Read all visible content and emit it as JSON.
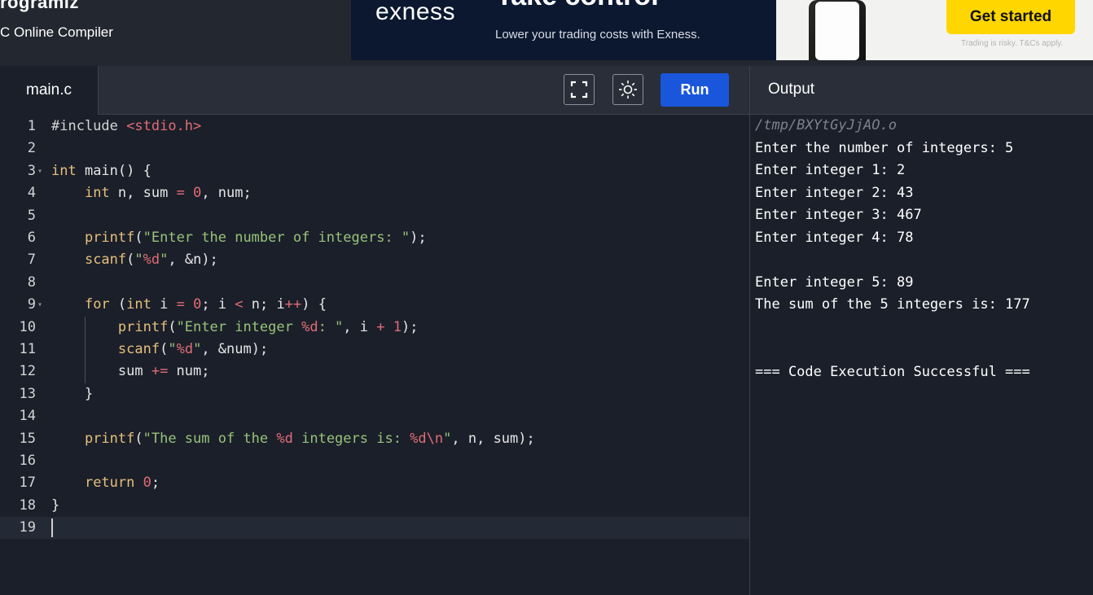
{
  "header": {
    "brand": "rogramiz",
    "subtitle": "C Online Compiler"
  },
  "ad": {
    "logo": "exness",
    "headline": "Take control",
    "tagline": "Lower your trading costs with Exness.",
    "cta": "Get started",
    "disclaimer": "Trading is risky. T&Cs apply."
  },
  "editor": {
    "tab_label": "main.c",
    "run_label": "Run",
    "active_line": 19
  },
  "output": {
    "title": "Output",
    "path": "/tmp/BXYtGyJjAO.o",
    "lines": [
      "Enter the number of integers: 5",
      "Enter integer 1: 2",
      "Enter integer 2: 43",
      "Enter integer 3: 467",
      "Enter integer 4: 78",
      "",
      "Enter integer 5: 89",
      "The sum of the 5 integers is: 177",
      "",
      "",
      "=== Code Execution Successful ==="
    ]
  },
  "code_lines": [
    "#include <stdio.h>",
    "",
    "int main() {",
    "    int n, sum = 0, num;",
    "",
    "    printf(\"Enter the number of integers: \");",
    "    scanf(\"%d\", &n);",
    "",
    "    for (int i = 0; i < n; i++) {",
    "        printf(\"Enter integer %d: \", i + 1);",
    "        scanf(\"%d\", &num);",
    "        sum += num;",
    "    }",
    "",
    "    printf(\"The sum of the %d integers is: %d\\n\", n, sum);",
    "",
    "    return 0;",
    "}",
    ""
  ],
  "fold_lines": [
    3,
    9
  ],
  "colors": {
    "background": "#1b1f2a",
    "toolbar": "#2a2e38",
    "run_button": "#1a56db",
    "keyword": "#e5c07b",
    "string": "#98c379",
    "number": "#e06c75",
    "cta": "#ffd600"
  },
  "icons": {
    "fullscreen": "fullscreen-icon",
    "theme": "sun-icon"
  }
}
